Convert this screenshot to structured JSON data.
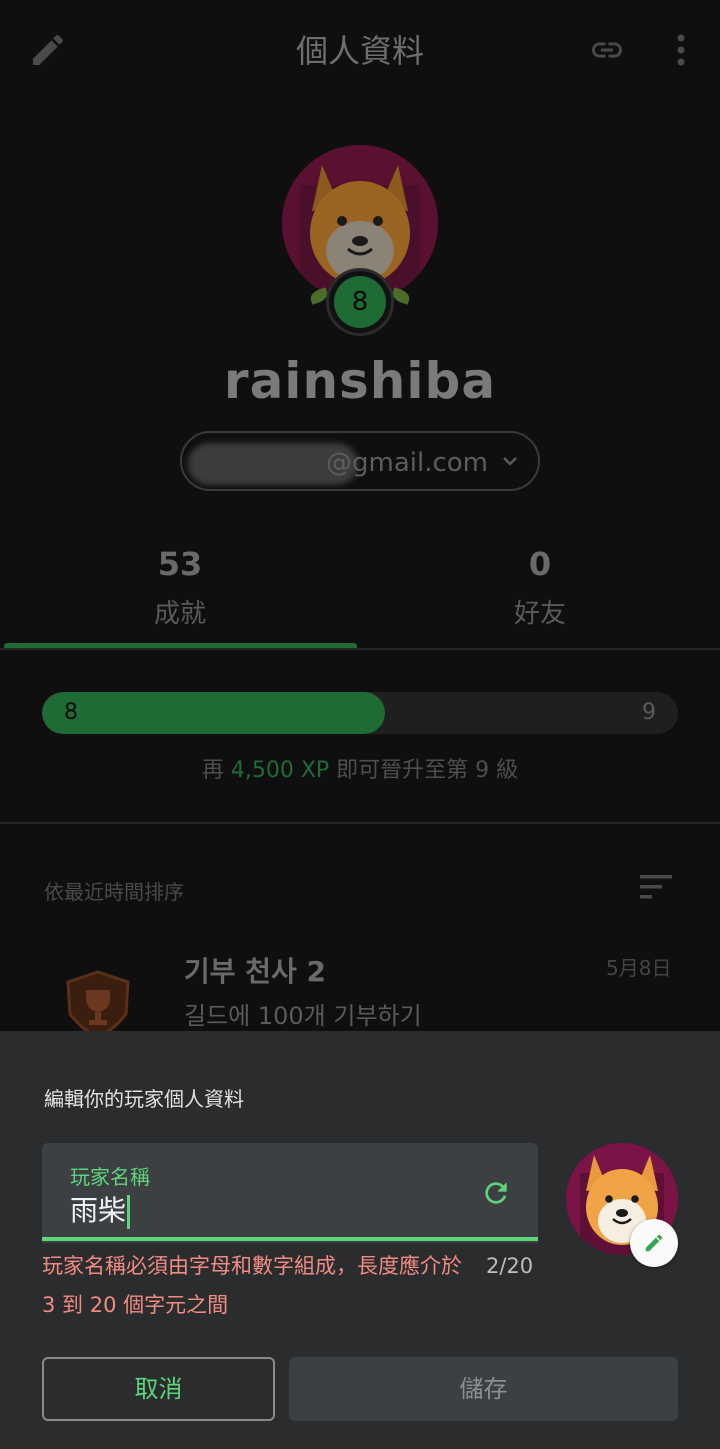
{
  "app_bar": {
    "title": "個人資料",
    "edit_icon": "pencil-icon",
    "link_icon": "link-icon",
    "more_icon": "more-vert-icon"
  },
  "profile": {
    "username": "rainshiba",
    "level": "8",
    "email_visible": "@gmail.com",
    "avatar": "shiba-dog-avatar"
  },
  "tabs": [
    {
      "count": "53",
      "label": "成就",
      "selected": true
    },
    {
      "count": "0",
      "label": "好友",
      "selected": false
    }
  ],
  "xp": {
    "current_level": "8",
    "next_level": "9",
    "progress": 0.54,
    "msg_prefix": "再",
    "msg_amount": "4,500 XP",
    "msg_suffix": "即可晉升至第 9 級"
  },
  "achievements": {
    "sort_label": "依最近時間排序",
    "items": [
      {
        "title": "기부 천사 2",
        "description": "길드에 100개 기부하기",
        "date": "5月8日",
        "icon": "trophy-badge-icon"
      }
    ]
  },
  "edit_sheet": {
    "title": "編輯你的玩家個人資料",
    "field_label": "玩家名稱",
    "field_value": "雨柴",
    "error_message": "玩家名稱必須由字母和數字組成，長度應介於 3 到 20 個字元之間",
    "counter": "2/20",
    "cancel_label": "取消",
    "save_label": "儲存"
  },
  "colors": {
    "accent_green": "#5fd57b",
    "error_red": "#f28b82",
    "level_green": "#1f6b35",
    "sheet_bg": "#2a2c2e"
  }
}
